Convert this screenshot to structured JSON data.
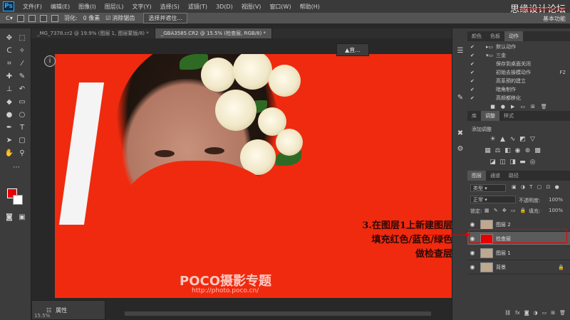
{
  "menubar": {
    "logo": "Ps",
    "items": [
      "文件(F)",
      "编辑(E)",
      "图像(I)",
      "图层(L)",
      "文字(Y)",
      "选择(S)",
      "滤镜(T)",
      "3D(D)",
      "视图(V)",
      "窗口(W)",
      "帮助(H)"
    ],
    "watermark": "思缘设计论坛",
    "watermark_url": "WWW.MISSYUAN.COM"
  },
  "options": {
    "feather_label": "羽化:",
    "feather_value": "0 像素",
    "antialias_label": "消除锯齿",
    "select_mask_button": "选择并遮住...",
    "workspace": "基本功能"
  },
  "tabs": [
    {
      "label": "_MG_7378.cr2 @ 19.9% (图层 1, 图层蒙版/8) *",
      "active": false
    },
    {
      "label": "_GBA3585.CR2 @ 15.5% (检查层, RGB/8) *",
      "active": true
    }
  ],
  "canvas": {
    "annotation_lines": [
      "3.在图层1上新建图层",
      "填充红色/蓝色/绿色",
      "做检查层"
    ],
    "poco_logo": "POCO摄影专题",
    "poco_url": "http://photo.poco.cn/",
    "info_icon": "i",
    "hist_label": "直...",
    "fill_color": "#f02a0e"
  },
  "properties_panel": {
    "label": "属性"
  },
  "right_panel": {
    "top_tabs": [
      "颜色",
      "色板",
      "动作"
    ],
    "actions": [
      {
        "label": "默认动作",
        "key": ""
      },
      {
        "label": "三金",
        "key": ""
      },
      {
        "label": "保存到桌面关闭",
        "key": ""
      },
      {
        "label": "初始去操模动作",
        "key": "F2"
      },
      {
        "label": "高系预的建立",
        "key": ""
      },
      {
        "label": "暗角制作",
        "key": ""
      },
      {
        "label": "高频都移化",
        "key": ""
      }
    ],
    "mid_tabs": [
      "库",
      "调整",
      "样式"
    ],
    "adjust_label": "添加调整",
    "layer_tabs": [
      "图层",
      "通道",
      "路径"
    ],
    "layer_kind": "类型",
    "blend_mode": "正常",
    "opacity_label": "不透明度:",
    "opacity_value": "100%",
    "lock_label": "锁定:",
    "fill_label": "填充:",
    "fill_value": "100%",
    "layers": [
      {
        "name": "图层 2",
        "selected": false,
        "thumb": "#bfa890"
      },
      {
        "name": "检查层",
        "selected": true,
        "thumb": "#e60000"
      },
      {
        "name": "图层 1",
        "selected": false,
        "thumb": "#bfa890"
      },
      {
        "name": "背景",
        "selected": false,
        "thumb": "#bfa890"
      }
    ]
  },
  "status": {
    "zoom": "15.5%"
  }
}
